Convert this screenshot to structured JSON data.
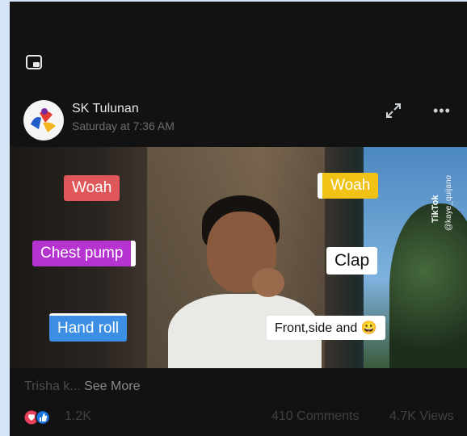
{
  "post": {
    "poster_name": "SK Tulunan",
    "timestamp": "Saturday at 7:36 AM"
  },
  "video": {
    "tags": {
      "woah_left": "Woah",
      "woah_right": "Woah",
      "chest_pump": "Chest pump",
      "clap": "Clap",
      "hand_roll": "Hand roll",
      "front_side": "Front,side and 😀"
    },
    "watermark_brand": "TikTok",
    "watermark_user": "@kaye_quijano"
  },
  "caption": {
    "text": "Trisha k...",
    "see_more": "See More"
  },
  "stats": {
    "reactions": "1.2K",
    "comments": "410 Comments",
    "views": "4.7K Views"
  },
  "icons": [
    "pip-icon",
    "expand-icon",
    "more-icon",
    "love-reaction-icon",
    "like-reaction-icon"
  ],
  "colors": {
    "background": "#121212",
    "tag_red": "#e05759",
    "tag_yellow": "#f1c216",
    "tag_purple": "#b533cf",
    "tag_blue": "#3d8fe6"
  }
}
